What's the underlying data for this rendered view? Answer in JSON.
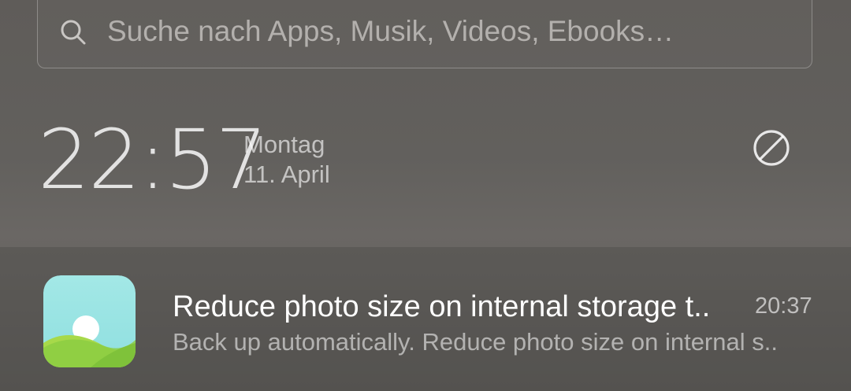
{
  "search": {
    "placeholder": "Suche nach Apps, Musik, Videos, Ebooks…",
    "icon": "search-icon"
  },
  "clock": {
    "time": "22:57",
    "day": "Montag",
    "date": "11. April"
  },
  "dnd": {
    "icon": "do-not-disturb-icon"
  },
  "notification": {
    "app_icon": "gallery-icon",
    "title": "Reduce photo size on internal storage t..",
    "time": "20:37",
    "text": "Back up automatically. Reduce photo size on internal s.."
  }
}
